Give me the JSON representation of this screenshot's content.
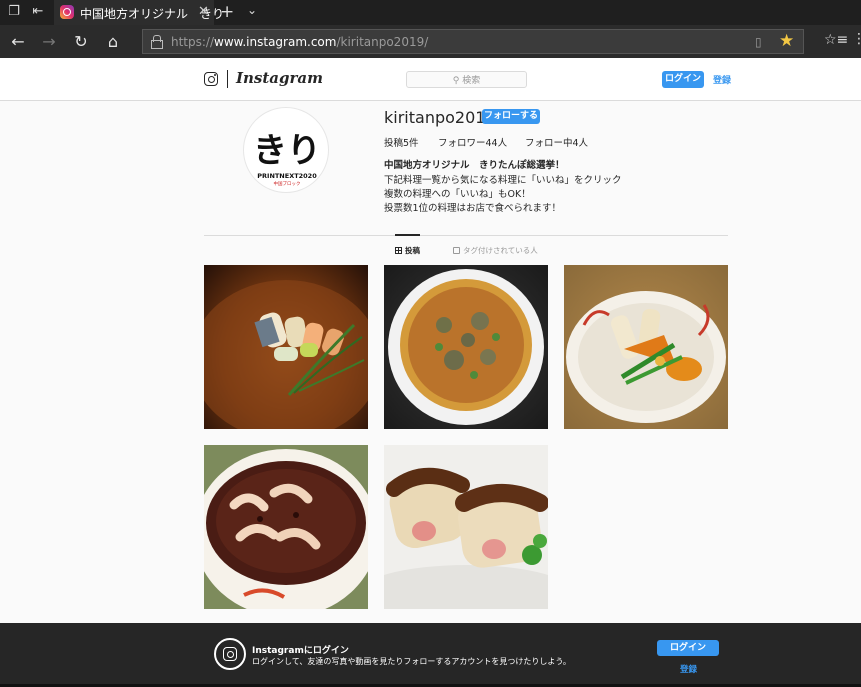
{
  "browser": {
    "tab_title": "中国地方オリジナル　きり",
    "url_prefix": "https://",
    "url_host": "www.instagram.com",
    "url_path": "/kiritanpo2019/",
    "icons": {
      "tab_actions": "tab-actions-icon",
      "set_aside": "set-aside-tabs-icon",
      "close": "close-icon",
      "new_tab": "plus-icon",
      "tab_menu": "chevron-down-icon",
      "back": "back-arrow-icon",
      "forward": "forward-arrow-icon",
      "refresh": "refresh-icon",
      "home": "home-icon",
      "lock": "lock-icon",
      "reading_view": "reading-view-icon",
      "favorite": "star-icon",
      "favorites_list": "favorites-icon",
      "more": "more-icon"
    },
    "accent_star": "#f2c744"
  },
  "header": {
    "wordmark": "Instagram",
    "search_placeholder": "検索",
    "login_label": "ログイン",
    "signup_label": "登録"
  },
  "profile": {
    "username": "kiritanpo2019",
    "follow_label": "フォローする",
    "stats": {
      "posts": "投稿5件",
      "followers": "フォロワー44人",
      "following": "フォロー中4人"
    },
    "bio": {
      "name": "中国地方オリジナル　きりたんぽ総選挙！",
      "lines": [
        "下記料理一覧から気になる料理に「いいね」をクリック",
        "複数の料理への「いいね」もOK！",
        "投票数1位の料理はお店で食べられます！"
      ]
    },
    "avatar": {
      "logo_mark": "きり",
      "logo_caption": "PRINTNEXT2020",
      "logo_sub": "中国ブロック"
    }
  },
  "tabs": {
    "posts": "投稿",
    "tagged": "タグ付けされている人"
  },
  "posts": [
    {
      "subject": "kiritanpo-sushi-plate"
    },
    {
      "subject": "kiritanpo-okonomiyaki"
    },
    {
      "subject": "kiritanpo-nimono-bowl"
    },
    {
      "subject": "kiritanpo-zenzai-soup"
    },
    {
      "subject": "kiritanpo-sausage-rolls"
    }
  ],
  "banner": {
    "title": "Instagramにログイン",
    "subtitle": "ログインして、友達の写真や動画を見たりフォローするアカウントを見つけたりしよう。",
    "login_label": "ログイン",
    "signup_label": "登録"
  },
  "colors": {
    "accent_blue": "#3897f0",
    "chrome_dark": "#2b2b2b",
    "banner_dark": "#262626"
  }
}
